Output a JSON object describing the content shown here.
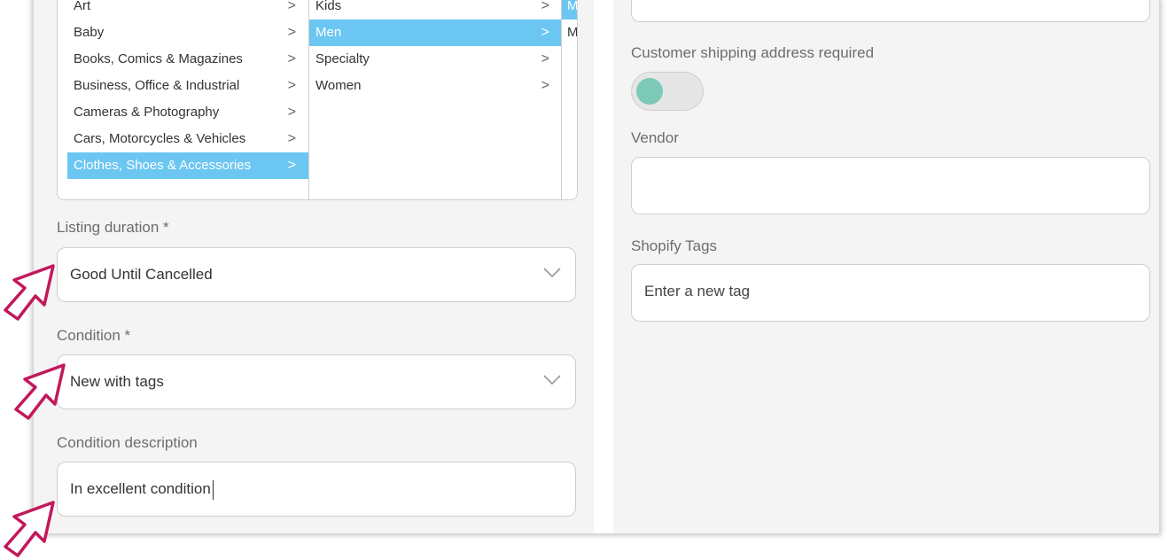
{
  "categories": {
    "col1": [
      {
        "label": "Art",
        "selected": false
      },
      {
        "label": "Baby",
        "selected": false
      },
      {
        "label": "Books, Comics & Magazines",
        "selected": false
      },
      {
        "label": "Business, Office & Industrial",
        "selected": false
      },
      {
        "label": "Cameras & Photography",
        "selected": false
      },
      {
        "label": "Cars, Motorcycles & Vehicles",
        "selected": false
      },
      {
        "label": "Clothes, Shoes & Accessories",
        "selected": true
      }
    ],
    "col2": [
      {
        "label": "Kids",
        "selected": false
      },
      {
        "label": "Men",
        "selected": true
      },
      {
        "label": "Specialty",
        "selected": false
      },
      {
        "label": "Women",
        "selected": false
      }
    ],
    "col3": [
      {
        "label": "M",
        "selected": true
      },
      {
        "label": "M",
        "selected": false
      }
    ],
    "chevron": ">"
  },
  "listing_duration": {
    "label": "Listing duration *",
    "value": "Good Until Cancelled"
  },
  "condition": {
    "label": "Condition *",
    "value": "New with tags"
  },
  "condition_description": {
    "label": "Condition description",
    "value": "In excellent condition"
  },
  "shipping": {
    "label": "Customer shipping address required",
    "toggle_on": false
  },
  "vendor": {
    "label": "Vendor",
    "value": ""
  },
  "shopify_tags": {
    "label": "Shopify Tags",
    "placeholder": "Enter a new tag"
  },
  "colors": {
    "accent": "#6cc6f2",
    "toggle_knob": "#7cc9b8",
    "pointer": "#c2185b"
  }
}
